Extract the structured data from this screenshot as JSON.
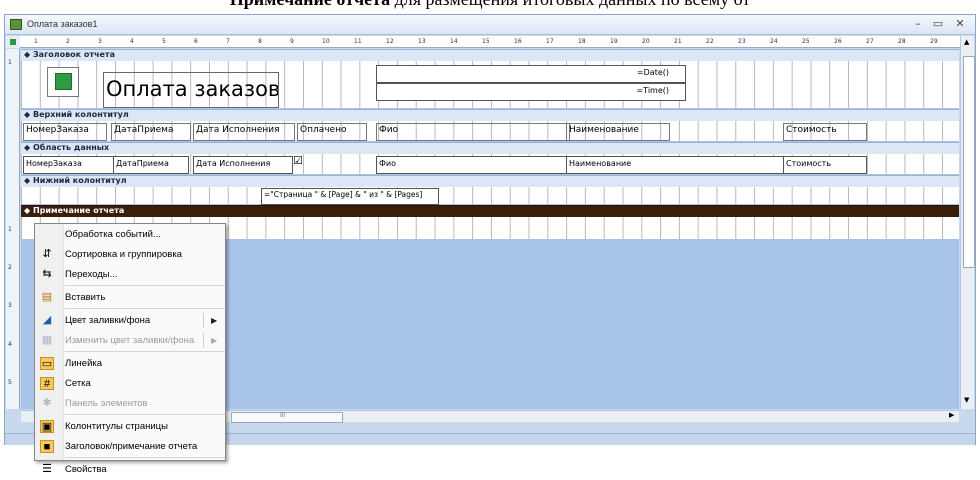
{
  "doc": {
    "heading_bold": "Примечание отчета",
    "heading_rest": " для размещения итоговых данных по всему от"
  },
  "window": {
    "title": "Оплата заказов1",
    "buttons": {
      "minimize": "–",
      "maximize": "▭",
      "close": "✕"
    }
  },
  "ruler": {
    "ticks": [
      "1",
      "2",
      "3",
      "4",
      "5",
      "6",
      "7",
      "8",
      "9",
      "10",
      "11",
      "12",
      "13",
      "14",
      "15",
      "16",
      "17",
      "18",
      "19",
      "20",
      "21",
      "22",
      "23",
      "24",
      "25",
      "26",
      "27",
      "28",
      "29"
    ]
  },
  "vruler": [
    "1",
    "1",
    "2",
    "3",
    "4",
    "5"
  ],
  "report": {
    "sections": {
      "report_header": "Заголовок отчета",
      "page_header": "Верхний колонтитул",
      "detail": "Область данных",
      "page_footer": "Нижний колонтитул",
      "report_footer": "Примечание отчета"
    },
    "title": "Оплата заказов",
    "date_expr": "=Date()",
    "time_expr": "=Time()",
    "header_labels": [
      "НомерЗаказа",
      "ДатаПриема",
      "Дата Исполнения",
      "Оплачено",
      "Фио",
      "Наименование",
      "Стоимость"
    ],
    "detail_fields": [
      "НомерЗаказа",
      "ДатаПриема",
      "Дата Исполнения",
      "Фио",
      "Наименование",
      "Стоимость"
    ],
    "checkbox": "☑",
    "page_expr": "=\"Страница \" & [Page] & \" из \" & [Pages]"
  },
  "context_menu": {
    "items": [
      {
        "label": "Обработка событий...",
        "icon": "",
        "disabled": false,
        "submenu": false
      },
      {
        "label": "Сортировка и группировка",
        "icon": "sort-icon",
        "disabled": false,
        "submenu": false
      },
      {
        "label": "Переходы...",
        "icon": "tab-order-icon",
        "disabled": false,
        "submenu": false
      },
      {
        "label": "Вставить",
        "icon": "paste-icon",
        "disabled": false,
        "submenu": false
      },
      {
        "label": "Цвет заливки/фона",
        "icon": "fill-color-icon",
        "disabled": false,
        "submenu": true
      },
      {
        "label": "Изменить цвет заливки/фона",
        "icon": "alt-fill-color-icon",
        "disabled": true,
        "submenu": true
      },
      {
        "label": "Линейка",
        "icon": "ruler-icon",
        "disabled": false,
        "submenu": false
      },
      {
        "label": "Сетка",
        "icon": "grid-icon",
        "disabled": false,
        "submenu": false
      },
      {
        "label": "Панель элементов",
        "icon": "toolbox-icon",
        "disabled": true,
        "submenu": false
      },
      {
        "label": "Колонтитулы страницы",
        "icon": "page-header-footer-icon",
        "disabled": false,
        "submenu": false
      },
      {
        "label": "Заголовок/примечание отчета",
        "icon": "report-header-footer-icon",
        "disabled": false,
        "submenu": false
      },
      {
        "label": "Свойства",
        "icon": "properties-icon",
        "disabled": false,
        "submenu": false
      }
    ],
    "submenu_arrow": "▶",
    "glyphs": {
      "sort": "⇵",
      "tab": "⇆",
      "paste": "▤",
      "fill": "◢",
      "alt": "▦",
      "ruler": "▭",
      "grid": "#",
      "toolbox": "✱",
      "hf": "▣",
      "rh": "■",
      "props": "☰"
    }
  },
  "scroll": {
    "thumb_mark": "III",
    "arrows": {
      "up": "▲",
      "down": "▼",
      "left": "◀",
      "right": "▶"
    }
  }
}
